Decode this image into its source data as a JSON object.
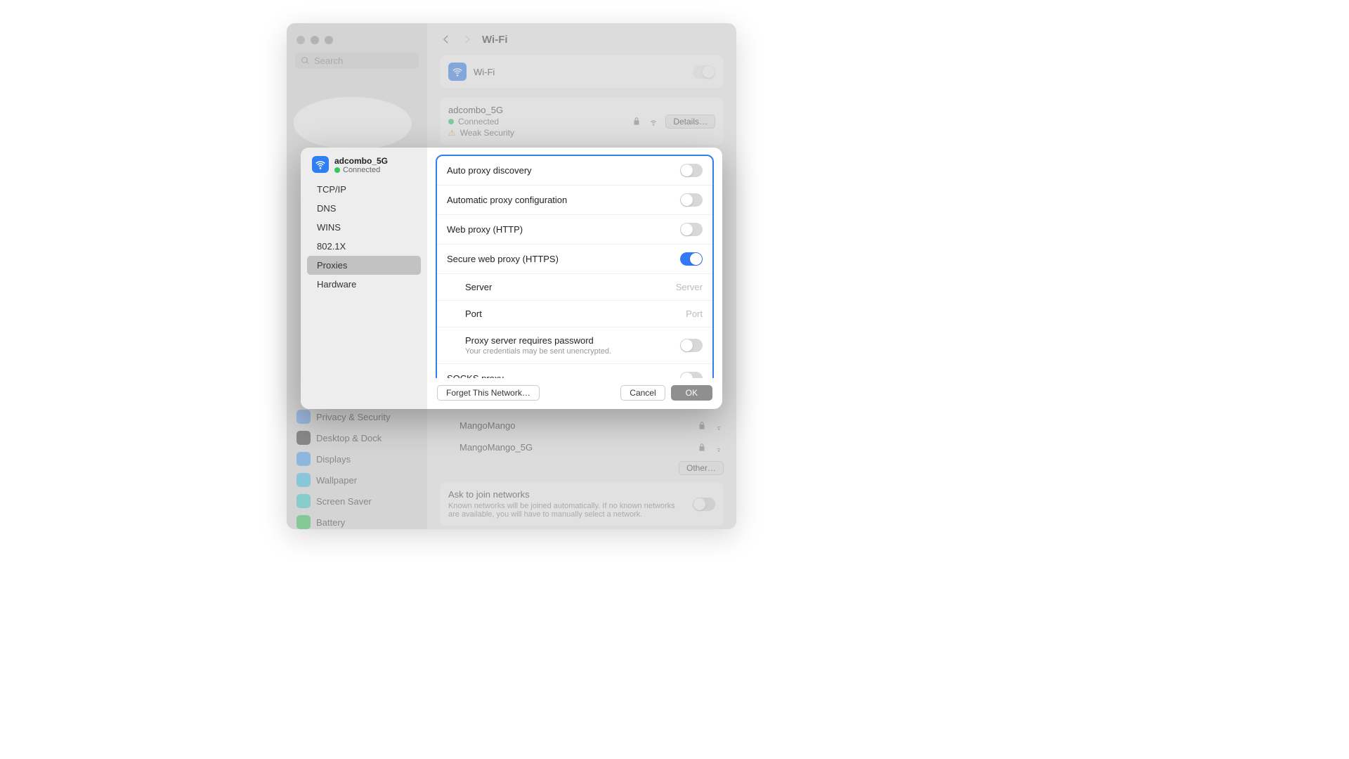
{
  "window": {
    "search_placeholder": "Search",
    "title": "Wi-Fi"
  },
  "sidebar": {
    "items": [
      {
        "label": "Privacy & Security"
      },
      {
        "label": "Desktop & Dock"
      },
      {
        "label": "Displays"
      },
      {
        "label": "Wallpaper"
      },
      {
        "label": "Screen Saver"
      },
      {
        "label": "Battery"
      }
    ]
  },
  "wifi": {
    "label": "Wi-Fi",
    "network": "adcombo_5G",
    "status": "Connected",
    "security": "Weak Security",
    "details_btn": "Details…",
    "other_net1": "MangoMango",
    "other_net2": "MangoMango_5G",
    "other_btn": "Other…",
    "ask_title": "Ask to join networks",
    "ask_desc": "Known networks will be joined automatically. If no known networks are available, you will have to manually select a network."
  },
  "sheet": {
    "network": "adcombo_5G",
    "status": "Connected",
    "tabs": {
      "tcpip": "TCP/IP",
      "dns": "DNS",
      "wins": "WINS",
      "dot1x": "802.1X",
      "proxies": "Proxies",
      "hardware": "Hardware"
    },
    "proxies": {
      "auto_discovery": "Auto proxy discovery",
      "auto_config": "Automatic proxy configuration",
      "web_proxy": "Web proxy (HTTP)",
      "secure_proxy": "Secure web proxy (HTTPS)",
      "server_label": "Server",
      "server_placeholder": "Server",
      "port_label": "Port",
      "port_placeholder": "Port",
      "requires_pw": "Proxy server requires password",
      "pw_note": "Your credentials may be sent unencrypted.",
      "socks": "SOCKS proxy"
    },
    "footer": {
      "forget": "Forget This Network…",
      "cancel": "Cancel",
      "ok": "OK"
    }
  }
}
